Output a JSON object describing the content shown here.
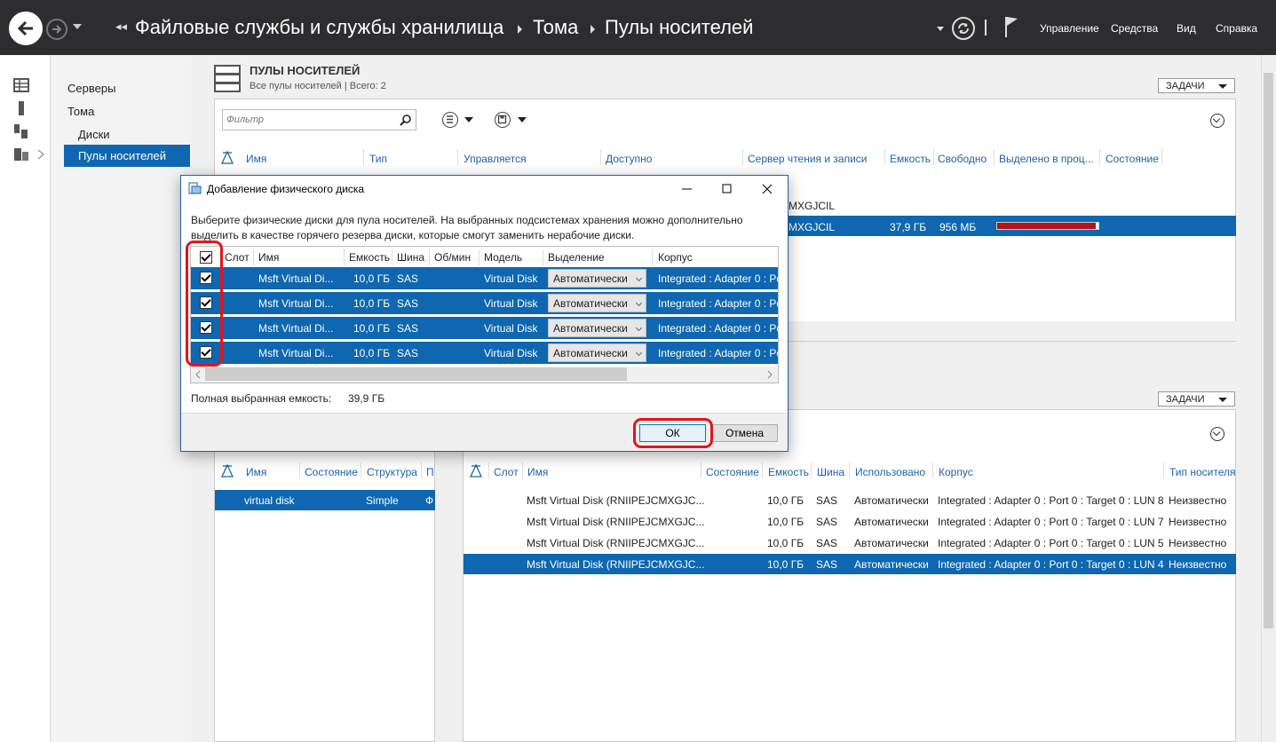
{
  "titlebar": {
    "breadcrumb": [
      "Файловые службы и службы хранилища",
      "Тома",
      "Пулы носителей"
    ],
    "menu": [
      "Управление",
      "Средства",
      "Вид",
      "Справка"
    ]
  },
  "leftnav": {
    "items": [
      {
        "label": "Серверы"
      },
      {
        "label": "Тома"
      },
      {
        "label": "Диски"
      },
      {
        "label": "Пулы носителей"
      }
    ]
  },
  "pools": {
    "title": "ПУЛЫ НОСИТЕЛЕЙ",
    "subtitle": "Все пулы носителей | Всего: 2",
    "tasks_label": "ЗАДАЧИ",
    "filter_placeholder": "Фильтр",
    "columns": [
      "Имя",
      "Тип",
      "Управляется",
      "Доступно",
      "Сервер чтения и записи",
      "Емкость",
      "Свободно",
      "Выделено в проц...",
      "Состояние"
    ],
    "rows": [
      {
        "server": "MXGJCIL"
      },
      {
        "server": "MXGJCIL",
        "capacity": "37,9 ГБ",
        "free": "956 МБ",
        "allocated_percent": 96
      }
    ]
  },
  "vdisks": {
    "tasks_label": "ЗАДАЧИ",
    "columns": [
      "Имя",
      "Состояние",
      "Структура",
      "П"
    ],
    "rows": [
      {
        "name": "virtual disk",
        "layout": "Simple",
        "extra": "Ф"
      }
    ]
  },
  "physdisks": {
    "columns": [
      "Слот",
      "Имя",
      "Состояние",
      "Емкость",
      "Шина",
      "Использовано",
      "Корпус",
      "Тип носителя"
    ],
    "rows": [
      {
        "name": "Msft Virtual Disk (RNIIPEJCMXGJC...",
        "capacity": "10,0 ГБ",
        "bus": "SAS",
        "usage": "Автоматически",
        "chassis": "Integrated : Adapter 0 : Port 0 : Target 0 : LUN 8",
        "media": "Неизвестно"
      },
      {
        "name": "Msft Virtual Disk (RNIIPEJCMXGJC...",
        "capacity": "10,0 ГБ",
        "bus": "SAS",
        "usage": "Автоматически",
        "chassis": "Integrated : Adapter 0 : Port 0 : Target 0 : LUN 7",
        "media": "Неизвестно"
      },
      {
        "name": "Msft Virtual Disk (RNIIPEJCMXGJC...",
        "capacity": "10,0 ГБ",
        "bus": "SAS",
        "usage": "Автоматически",
        "chassis": "Integrated : Adapter 0 : Port 0 : Target 0 : LUN 5",
        "media": "Неизвестно"
      },
      {
        "name": "Msft Virtual Disk (RNIIPEJCMXGJC...",
        "capacity": "10,0 ГБ",
        "bus": "SAS",
        "usage": "Автоматически",
        "chassis": "Integrated : Adapter 0 : Port 0 : Target 0 : LUN 4",
        "media": "Неизвестно"
      }
    ]
  },
  "dialog": {
    "title": "Добавление физического диска",
    "description": "Выберите физические диски для пула носителей. На выбранных подсистемах хранения можно дополнительно выделить в качестве горячего резерва диски, которые смогут заменить нерабочие диски.",
    "columns": [
      "Слот",
      "Имя",
      "Емкость",
      "Шина",
      "Об/мин",
      "Модель",
      "Выделение",
      "Корпус"
    ],
    "rows": [
      {
        "name": "Msft Virtual Di...",
        "capacity": "10,0 ГБ",
        "bus": "SAS",
        "model": "Virtual Disk",
        "allocation": "Автоматически",
        "chassis": "Integrated : Adapter 0 : Po"
      },
      {
        "name": "Msft Virtual Di...",
        "capacity": "10,0 ГБ",
        "bus": "SAS",
        "model": "Virtual Disk",
        "allocation": "Автоматически",
        "chassis": "Integrated : Adapter 0 : Po"
      },
      {
        "name": "Msft Virtual Di...",
        "capacity": "10,0 ГБ",
        "bus": "SAS",
        "model": "Virtual Disk",
        "allocation": "Автоматически",
        "chassis": "Integrated : Adapter 0 : Po"
      },
      {
        "name": "Msft Virtual Di...",
        "capacity": "10,0 ГБ",
        "bus": "SAS",
        "model": "Virtual Disk",
        "allocation": "Автоматически",
        "chassis": "Integrated : Adapter 0 : Po"
      }
    ],
    "total_label": "Полная выбранная емкость:",
    "total_value": "39,9 ГБ",
    "ok_label": "ОК",
    "cancel_label": "Отмена"
  },
  "colors": {
    "accent": "#0e67b0",
    "titlebar": "#2d2d30",
    "highlight": "#e3141e",
    "alloc_bar": "#b5121b"
  }
}
